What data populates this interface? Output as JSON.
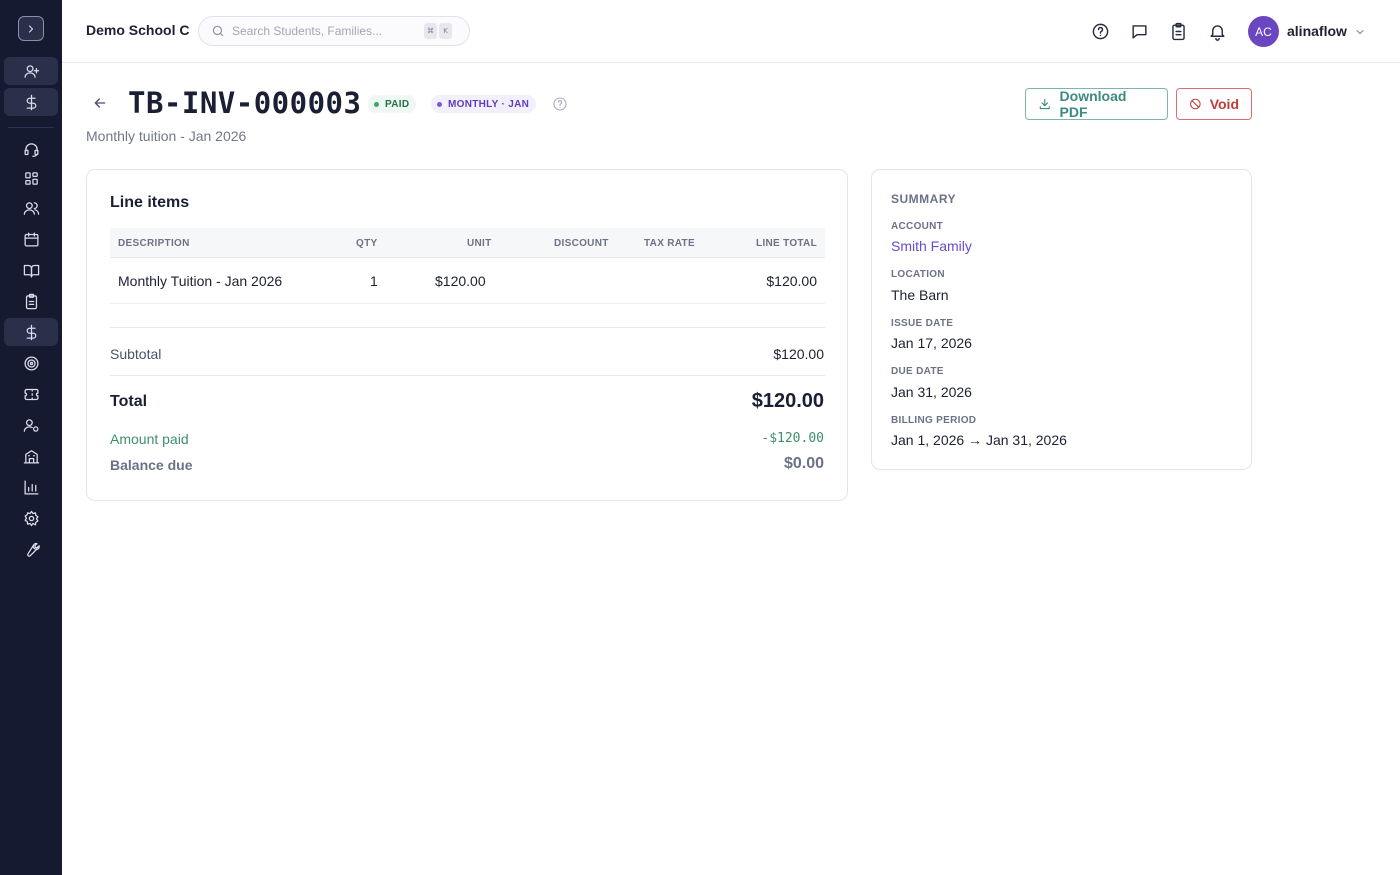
{
  "app": {
    "school_name": "Demo School C",
    "search_placeholder": "Search Students, Families...",
    "shortcut_keys": [
      "⌘",
      "K"
    ],
    "user": {
      "initials": "AC",
      "name": "alinaflow"
    }
  },
  "sidebar": {
    "items": [
      {
        "name": "add-student",
        "icon": "user-plus-icon"
      },
      {
        "name": "billing-quick",
        "icon": "dollar-icon"
      },
      {
        "name": "support",
        "icon": "headset-icon"
      },
      {
        "name": "dashboard",
        "icon": "grid-icon"
      },
      {
        "name": "people",
        "icon": "users-icon"
      },
      {
        "name": "calendar",
        "icon": "calendar-icon"
      },
      {
        "name": "curriculum",
        "icon": "book-icon"
      },
      {
        "name": "tasks",
        "icon": "clipboard-icon"
      },
      {
        "name": "billing",
        "icon": "dollar-icon",
        "active": true
      },
      {
        "name": "goals",
        "icon": "target-icon"
      },
      {
        "name": "tickets",
        "icon": "ticket-icon"
      },
      {
        "name": "staff",
        "icon": "user-settings-icon"
      },
      {
        "name": "buildings",
        "icon": "building-icon"
      },
      {
        "name": "reports",
        "icon": "bar-chart-icon"
      },
      {
        "name": "settings",
        "icon": "gear-icon"
      },
      {
        "name": "tools",
        "icon": "wrench-icon"
      }
    ]
  },
  "invoice": {
    "id": "TB-INV-000003",
    "status_badge": "PAID",
    "period_badge": "MONTHLY · JAN",
    "description": "Monthly tuition - Jan 2026",
    "actions": {
      "download": "Download PDF",
      "void": "Void"
    },
    "colors": {
      "paid": "#27704a",
      "period": "#5b3fb8",
      "download": "#3d8a80",
      "void": "#c03c38",
      "amount_paid": "#3f8f6a"
    }
  },
  "line_items": {
    "title": "Line items",
    "columns": [
      "DESCRIPTION",
      "QTY",
      "UNIT",
      "DISCOUNT",
      "TAX RATE",
      "LINE TOTAL"
    ],
    "rows": [
      {
        "description": "Monthly Tuition - Jan 2026",
        "qty": "1",
        "unit": "$120.00",
        "discount": "",
        "tax_rate": "",
        "line_total": "$120.00"
      }
    ],
    "totals": {
      "subtotal_label": "Subtotal",
      "subtotal": "$120.00",
      "total_label": "Total",
      "total": "$120.00",
      "amount_paid_label": "Amount paid",
      "amount_paid": "-$120.00",
      "balance_due_label": "Balance due",
      "balance_due": "$0.00"
    }
  },
  "summary": {
    "heading": "SUMMARY",
    "account_label": "ACCOUNT",
    "account": "Smith Family",
    "location_label": "LOCATION",
    "location": "The Barn",
    "issue_date_label": "ISSUE DATE",
    "issue_date": "Jan 17, 2026",
    "due_date_label": "DUE DATE",
    "due_date": "Jan 31, 2026",
    "billing_period_label": "BILLING PERIOD",
    "billing_period": "Jan 1, 2026 → Jan 31, 2026"
  }
}
